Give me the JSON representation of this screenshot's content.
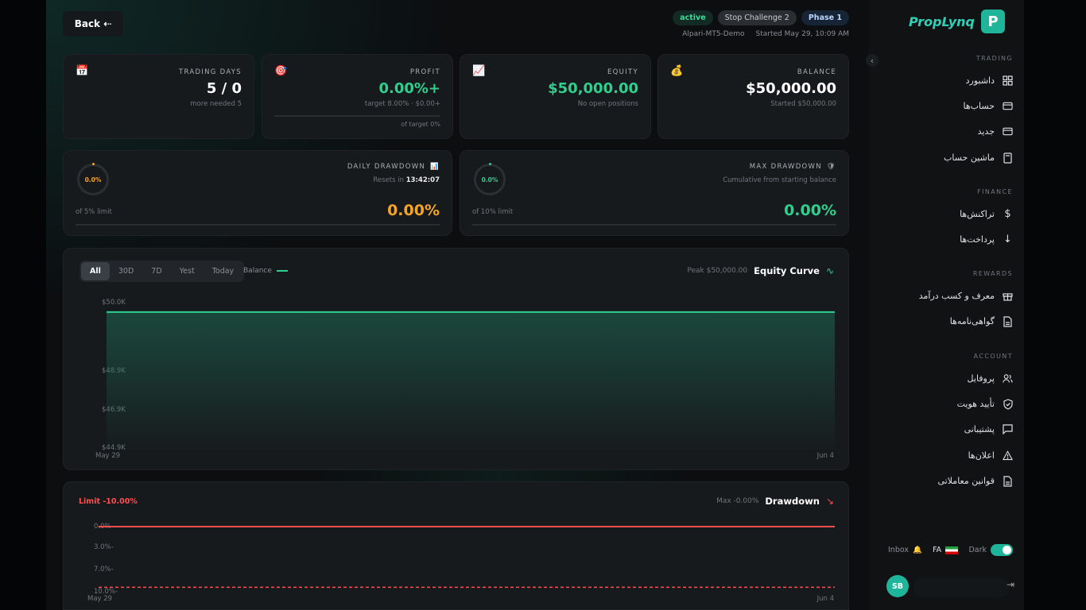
{
  "header": {
    "back_label": "Back ⇠",
    "badges": {
      "status": "active",
      "stop": "Stop Challenge 2",
      "phase": "Phase 1"
    },
    "account": "Alpari-MT5-Demo",
    "started": "Started May 29, 10:09 AM"
  },
  "stats": [
    {
      "icon": "calendar-icon",
      "label": "TRADING DAYS",
      "value": "5 / 0",
      "sub": "more needed 5"
    },
    {
      "icon": "target-icon",
      "label": "PROFIT",
      "value": "0.00%+",
      "sub": "target 8.00% · $0.00+",
      "sub2": "of target 0%"
    },
    {
      "icon": "chart-up-icon",
      "label": "EQUITY",
      "value": "$50,000.00",
      "sub": "No open positions"
    },
    {
      "icon": "money-bag-icon",
      "label": "BALANCE",
      "value": "$50,000.00",
      "sub": "Started $50,000.00"
    }
  ],
  "drawdowns": {
    "daily": {
      "label": "DAILY DRAWDOWN",
      "reset_prefix": "Resets in",
      "reset_time": "13:42:07",
      "ring": "0.0%",
      "limit": "of 5% limit",
      "value": "0.00%"
    },
    "max": {
      "label": "MAX DRAWDOWN",
      "sub": "Cumulative from starting balance",
      "ring": "0.0%",
      "limit": "of 10% limit",
      "value": "0.00%"
    }
  },
  "equity_chart": {
    "tabs": [
      "All",
      "30D",
      "7D",
      "Yest",
      "Today"
    ],
    "selected_tab": "All",
    "legend": "Balance",
    "peak": "Peak $50,000.00",
    "title": "Equity Curve",
    "y_ticks": [
      "$50.0K",
      "$48.9K",
      "$46.9K",
      "$44.9K"
    ],
    "x_ticks": [
      "May 29",
      "Jun 4"
    ]
  },
  "drawdown_chart": {
    "limit_label": "Limit -10.00%",
    "max_label": "Max -0.00%",
    "title": "Drawdown",
    "y_ticks": [
      "0.0%",
      "3.0%-",
      "7.0%-",
      "10.0%-"
    ],
    "x_ticks": [
      "May 29",
      "Jun 4"
    ]
  },
  "chart_data": [
    {
      "type": "area",
      "title": "Equity Curve",
      "x": [
        "May 29",
        "Jun 4"
      ],
      "series": [
        {
          "name": "Balance",
          "values": [
            50000,
            50000
          ]
        }
      ],
      "ylim": [
        44900,
        50000
      ],
      "colors": {
        "line": "#2fd08f"
      }
    },
    {
      "type": "line",
      "title": "Drawdown",
      "x": [
        "May 29",
        "Jun 4"
      ],
      "series": [
        {
          "values": [
            0,
            0
          ]
        }
      ],
      "limit": -10,
      "ylim": [
        -10,
        0
      ],
      "colors": {
        "line": "#ff4d4f"
      }
    }
  ],
  "sidebar": {
    "brand": "PropLynq",
    "brand_mark": "P",
    "sections": [
      {
        "title": "TRADING",
        "items": [
          {
            "label": "داشبورد",
            "icon": "grid-icon"
          },
          {
            "label": "حساب‌ها",
            "icon": "card-icon"
          },
          {
            "label": "جدید",
            "icon": "card-icon"
          },
          {
            "label": "ماشین حساب",
            "icon": "calculator-icon"
          }
        ]
      },
      {
        "title": "FINANCE",
        "items": [
          {
            "label": "تراکنش‌ها",
            "icon": "dollar-icon"
          },
          {
            "label": "پرداخت‌ها",
            "icon": "arrow-down-icon"
          }
        ]
      },
      {
        "title": "REWARDS",
        "items": [
          {
            "label": "معرف و کسب درآمد",
            "icon": "gift-icon"
          },
          {
            "label": "گواهی‌نامه‌ها",
            "icon": "document-icon"
          }
        ]
      },
      {
        "title": "ACCOUNT",
        "items": [
          {
            "label": "پروفایل",
            "icon": "users-icon"
          },
          {
            "label": "تأیید هویت",
            "icon": "shield-check-icon"
          },
          {
            "label": "پشتیبانی",
            "icon": "chat-icon"
          },
          {
            "label": "اعلان‌ها",
            "icon": "warning-icon"
          },
          {
            "label": "قوانین معاملاتی",
            "icon": "document-icon"
          }
        ]
      }
    ],
    "footer": {
      "inbox": "Inbox",
      "lang": "FA",
      "theme": "Dark",
      "avatar": "SB"
    }
  },
  "colors": {
    "accent": "#2fd08f",
    "warning": "#f5a524",
    "danger": "#ff4d4f",
    "brand": "#1fb59a"
  }
}
